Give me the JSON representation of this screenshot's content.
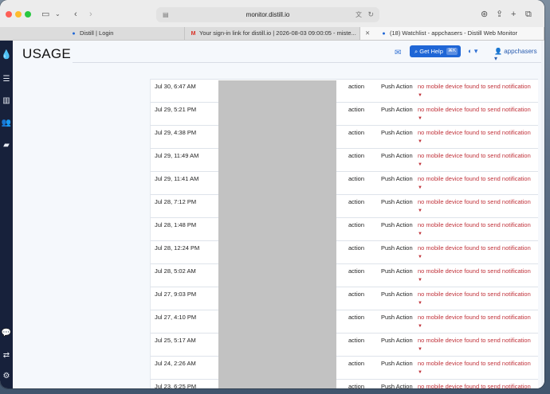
{
  "browser": {
    "url": "monitor.distill.io",
    "tabs": [
      {
        "title": "Distill | Login",
        "icon": "distill-drop-icon"
      },
      {
        "title": "Your sign-in link for distill.io | 2026-08-03 09:00:05 - miste...",
        "icon": "gmail-icon"
      },
      {
        "title": "(18) Watchlist - appchasers - Distill Web Monitor",
        "icon": "close-icon"
      }
    ]
  },
  "app": {
    "page_title": "USAGE",
    "help_label": "Get Help",
    "help_shortcut": "⌘K",
    "username": "appchasers"
  },
  "table": {
    "rows": [
      {
        "date": "Jul 30, 6:47 AM",
        "type": "action",
        "channel": "Push Action",
        "message": "no mobile device found to send notification"
      },
      {
        "date": "Jul 29, 5:21 PM",
        "type": "action",
        "channel": "Push Action",
        "message": "no mobile device found to send notification"
      },
      {
        "date": "Jul 29, 4:38 PM",
        "type": "action",
        "channel": "Push Action",
        "message": "no mobile device found to send notification"
      },
      {
        "date": "Jul 29, 11:49 AM",
        "type": "action",
        "channel": "Push Action",
        "message": "no mobile device found to send notification"
      },
      {
        "date": "Jul 29, 11:41 AM",
        "type": "action",
        "channel": "Push Action",
        "message": "no mobile device found to send notification"
      },
      {
        "date": "Jul 28, 7:12 PM",
        "type": "action",
        "channel": "Push Action",
        "message": "no mobile device found to send notification"
      },
      {
        "date": "Jul 28, 1:48 PM",
        "type": "action",
        "channel": "Push Action",
        "message": "no mobile device found to send notification"
      },
      {
        "date": "Jul 28, 12:24 PM",
        "type": "action",
        "channel": "Push Action",
        "message": "no mobile device found to send notification"
      },
      {
        "date": "Jul 28, 5:02 AM",
        "type": "action",
        "channel": "Push Action",
        "message": "no mobile device found to send notification"
      },
      {
        "date": "Jul 27, 9:03 PM",
        "type": "action",
        "channel": "Push Action",
        "message": "no mobile device found to send notification"
      },
      {
        "date": "Jul 27, 4:10 PM",
        "type": "action",
        "channel": "Push Action",
        "message": "no mobile device found to send notification"
      },
      {
        "date": "Jul 25, 5:17 AM",
        "type": "action",
        "channel": "Push Action",
        "message": "no mobile device found to send notification"
      },
      {
        "date": "Jul 24, 2:26 AM",
        "type": "action",
        "channel": "Push Action",
        "message": "no mobile device found to send notification"
      },
      {
        "date": "Jul 23, 6:25 PM",
        "type": "action",
        "channel": "Push Action",
        "message": "no mobile device found to send notification"
      }
    ]
  },
  "colors": {
    "sidebar": "#17213b",
    "accent": "#1f66d6",
    "error": "#c0323a"
  }
}
